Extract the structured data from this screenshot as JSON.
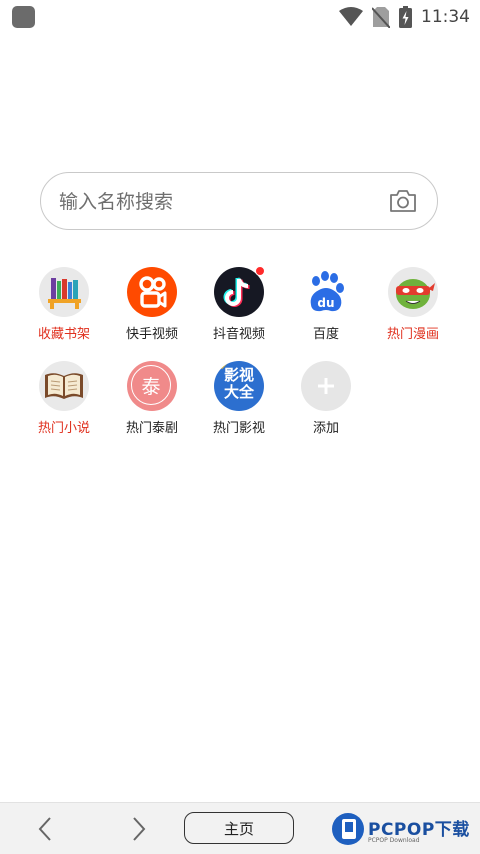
{
  "status_bar": {
    "time": "11:34"
  },
  "search": {
    "placeholder": "输入名称搜索"
  },
  "shortcuts_row1": [
    {
      "label": "收藏书架",
      "icon": "bookshelf-icon",
      "label_color": "red"
    },
    {
      "label": "快手视频",
      "icon": "kuaishou-icon"
    },
    {
      "label": "抖音视频",
      "icon": "douyin-icon"
    },
    {
      "label": "百度",
      "icon": "baidu-paw-icon"
    },
    {
      "label": "热门漫画",
      "icon": "ninja-turtle-icon",
      "label_color": "red"
    }
  ],
  "shortcuts_row2": [
    {
      "label": "热门小说",
      "icon": "open-book-icon",
      "label_color": "red"
    },
    {
      "label": "热门泰剧",
      "icon": "thai-drama-icon",
      "icon_text": "泰"
    },
    {
      "label": "热门影视",
      "icon": "film-tv-icon",
      "icon_text": [
        "影视",
        "大全"
      ]
    },
    {
      "label": "添加",
      "icon": "plus-icon"
    }
  ],
  "bottom_bar": {
    "home_label": "主页",
    "watermark_text": "PCPOP下载",
    "watermark_sub": "PCPOP Download"
  },
  "colors": {
    "label_red": "#e0301e",
    "kuaishou_orange": "#ff4a00",
    "douyin_dark": "#161823",
    "baidu_blue": "#2b6de5",
    "plus_gray": "#e6e6e6",
    "thai_pink": "#f08a8a"
  }
}
